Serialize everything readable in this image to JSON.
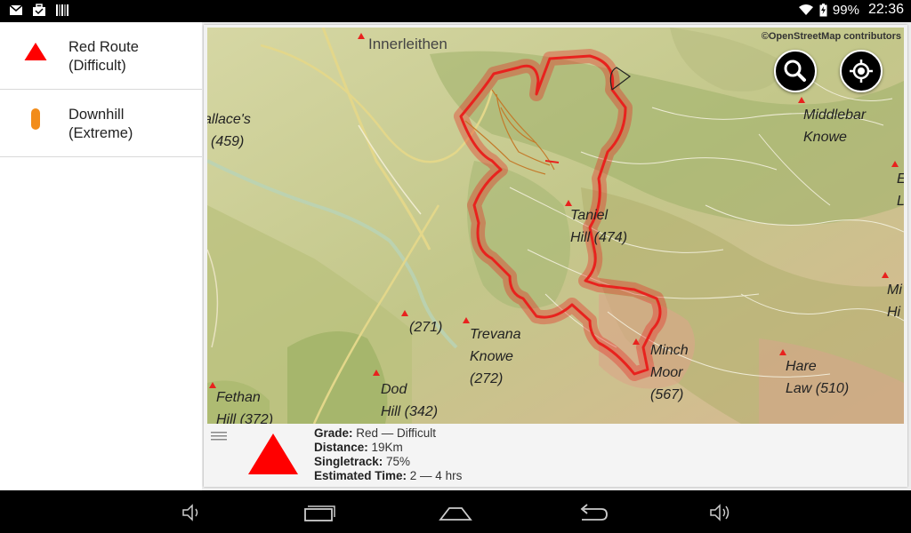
{
  "status": {
    "battery": "99%",
    "time": "22:36",
    "icons": [
      "gmail-icon",
      "briefcase-icon",
      "barcode-icon"
    ]
  },
  "sidebar": {
    "items": [
      {
        "label": "Red Route\n(Difficult)",
        "icon": "red-triangle-icon",
        "color": "#ff0000"
      },
      {
        "label": "Downhill\n(Extreme)",
        "icon": "orange-pill-icon",
        "color": "#f28c1a"
      }
    ]
  },
  "map": {
    "attribution": "©OpenStreetMap contributors",
    "town": "Innerleithen",
    "labels": [
      {
        "id": "wallace",
        "text": "allace's"
      },
      {
        "id": "wallace_h",
        "text": "(459)"
      },
      {
        "id": "middlebar1",
        "text": "Middlebar"
      },
      {
        "id": "middlebar2",
        "text": "Knowe"
      },
      {
        "id": "taniel1",
        "text": "Taniel"
      },
      {
        "id": "taniel2",
        "text": "Hill (474)"
      },
      {
        "id": "h271",
        "text": "(271)"
      },
      {
        "id": "trevana1",
        "text": "Trevana"
      },
      {
        "id": "trevana2",
        "text": "Knowe"
      },
      {
        "id": "trevana3",
        "text": "(272)"
      },
      {
        "id": "minch1",
        "text": "Minch"
      },
      {
        "id": "minch2",
        "text": "Moor"
      },
      {
        "id": "minch3",
        "text": "(567)"
      },
      {
        "id": "hare1",
        "text": "Hare"
      },
      {
        "id": "hare2",
        "text": "Law (510)"
      },
      {
        "id": "fethan1",
        "text": "Fethan"
      },
      {
        "id": "fethan2",
        "text": "Hill (372)"
      },
      {
        "id": "dod1",
        "text": "Dod"
      },
      {
        "id": "dod2",
        "text": "Hill (342)"
      },
      {
        "id": "e1",
        "text": "E"
      },
      {
        "id": "e2",
        "text": "L"
      },
      {
        "id": "mi1",
        "text": "Mi"
      },
      {
        "id": "mi2",
        "text": "Hi"
      }
    ],
    "buttons": {
      "search": "search-icon",
      "locate": "locate-icon"
    },
    "route_color": "#e8221e"
  },
  "info": {
    "grade_label": "Grade:",
    "grade_value": " Red — Difficult",
    "distance_label": "Distance:",
    "distance_value": " 19Km",
    "singletrack_label": "Singletrack:",
    "singletrack_value": " 75%",
    "time_label": "Estimated Time:",
    "time_value": " 2 — 4 hrs"
  },
  "navbar": {
    "icons": [
      "volume-down-icon",
      "recents-icon",
      "home-icon",
      "back-icon",
      "volume-up-icon"
    ]
  }
}
